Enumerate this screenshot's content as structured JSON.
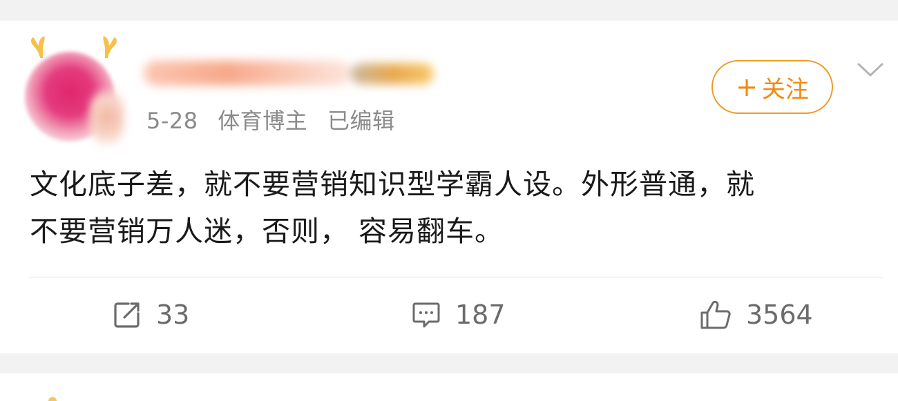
{
  "post": {
    "date": "5-28",
    "user_tag": "体育博主",
    "edited_label": "已编辑",
    "follow_label": "关注",
    "follow_plus": "+",
    "text_line1": "文化底子差，就不要营销知识型学霸人设。外形普通，就",
    "text_line2": "不要营销万人迷，否则， 容易翻车。"
  },
  "actions": {
    "repost_count": "33",
    "comment_count": "187",
    "like_count": "3564"
  },
  "colors": {
    "accent": "#f08a12",
    "meta_text": "#8a8a8a",
    "body_text": "#1a1a1a"
  }
}
